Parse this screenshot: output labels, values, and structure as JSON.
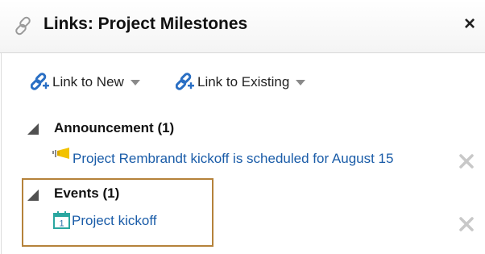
{
  "panel": {
    "title": "Links: Project Milestones",
    "close_label": "×"
  },
  "toolbar": {
    "link_new_label": "Link to New",
    "link_existing_label": "Link to Existing"
  },
  "sections": [
    {
      "heading": "Announcement (1)",
      "items": [
        {
          "label": "Project Rembrandt kickoff is scheduled for August 15",
          "icon": "megaphone-icon"
        }
      ]
    },
    {
      "heading": "Events (1)",
      "items": [
        {
          "label": "Project kickoff",
          "icon": "calendar-icon",
          "icon_day": "1"
        }
      ]
    }
  ],
  "colors": {
    "link": "#1a5ca8",
    "highlight": "#b5823a",
    "chain_icon": "#2a6fc4",
    "megaphone": "#f2c200",
    "calendar": "#2aa7a0"
  }
}
